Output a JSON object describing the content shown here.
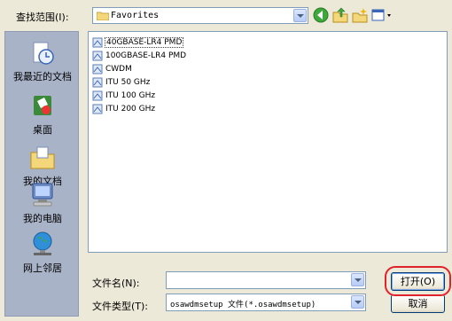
{
  "look_in": {
    "label": "查找范围(I):",
    "value": "Favorites"
  },
  "places": [
    "我最近的文档",
    "桌面",
    "我的文档",
    "我的电脑",
    "网上邻居"
  ],
  "files": [
    "40GBASE-LR4 PMD",
    "100GBASE-LR4 PMD",
    "CWDM",
    "ITU 50 GHz",
    "ITU 100 GHz",
    "ITU 200 GHz"
  ],
  "file_name": {
    "label": "文件名(N):",
    "value": ""
  },
  "file_type": {
    "label": "文件类型(T):",
    "value": "osawdmsetup 文件(*.osawdmsetup)"
  },
  "buttons": {
    "open": "打开(O)",
    "cancel": "取消"
  },
  "icons": {
    "back": "back-arrow-icon",
    "up": "up-folder-icon",
    "new_folder": "new-folder-icon",
    "views": "views-menu-icon",
    "folder": "folder-icon",
    "file": "file-icon"
  },
  "colors": {
    "highlight": "#e2222a",
    "places_bg": "#a9b3c8",
    "window_bg": "#ece9d8"
  }
}
